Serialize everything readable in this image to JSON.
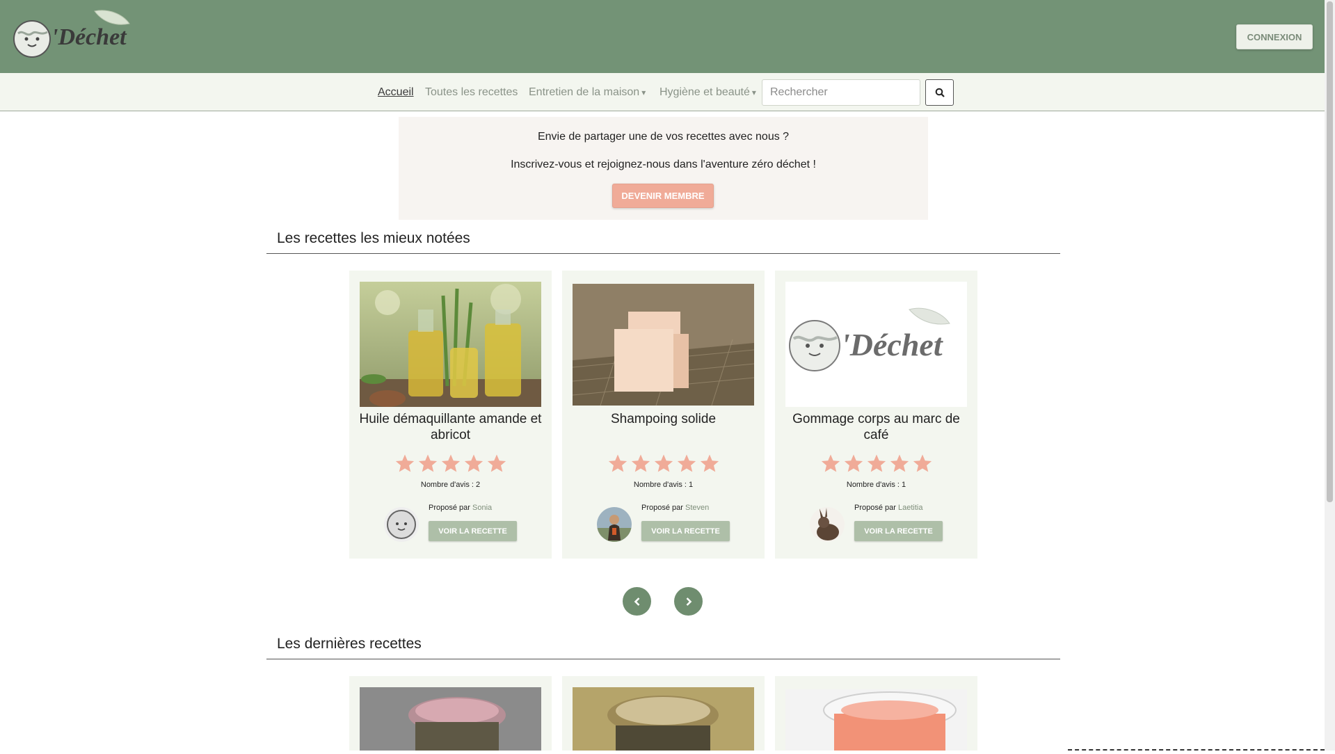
{
  "header": {
    "logo_text": "'Déchet",
    "login_label": "CONNEXION"
  },
  "nav": {
    "items": [
      {
        "label": "Accueil"
      },
      {
        "label": "Toutes les recettes"
      },
      {
        "label": "Entretien de la maison",
        "caret": "▾"
      },
      {
        "label": "Hygiène et beauté",
        "caret": "▾"
      }
    ],
    "search_placeholder": "Rechercher"
  },
  "promo": {
    "question": "Envie de partager une de vos recettes avec nous ?",
    "text": "Inscrivez-vous et rejoignez-nous dans l'aventure zéro déchet !",
    "button": "DEVENIR MEMBRE"
  },
  "top_rated": {
    "title": "Les recettes les mieux notées",
    "cards": [
      {
        "title": "Huile démaquillante amande et abricot",
        "rating": 5,
        "reviews": "Nombre d'avis : 2",
        "proposed_by": "Proposé par",
        "author": "Sonia",
        "button": "VOIR LA RECETTE"
      },
      {
        "title": "Shampoing solide",
        "rating": 5,
        "reviews": "Nombre d'avis : 1",
        "proposed_by": "Proposé par",
        "author": "Steven",
        "button": "VOIR LA RECETTE"
      },
      {
        "title": "Gommage corps au marc de café",
        "rating": 5,
        "reviews": "Nombre d'avis : 1",
        "proposed_by": "Proposé par",
        "author": "Laetitia",
        "button": "VOIR LA RECETTE"
      }
    ]
  },
  "latest": {
    "title": "Les dernières recettes"
  },
  "colors": {
    "header": "#739376",
    "nav": "#f3f6ef",
    "star": "#f0ab98",
    "accent_button": "#aebfa8",
    "carousel": "#6f8d6f"
  }
}
